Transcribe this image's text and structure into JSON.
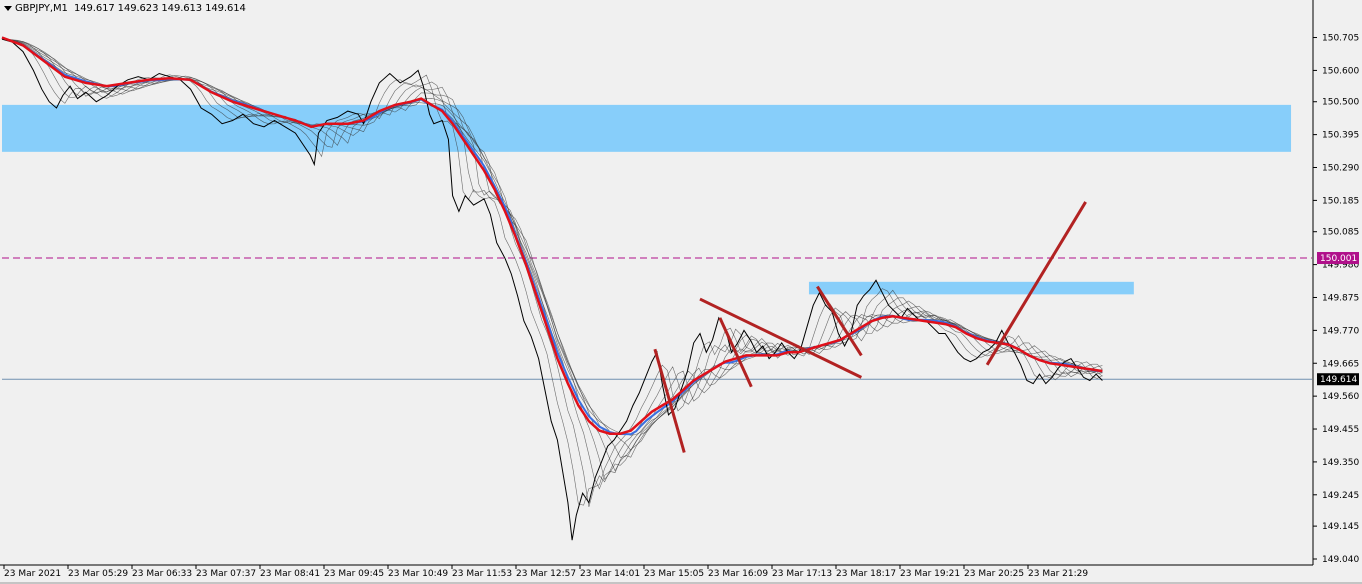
{
  "header": {
    "symbol": "GBPJPY,M1",
    "ohlc": "149.617 149.623 149.613 149.614"
  },
  "colors": {
    "background": "#f0f0f0",
    "price_line": "#000000",
    "ma_slow": "#e0101a",
    "ma_mid": "#3a6fe0",
    "zone_fill": "#87cefa",
    "level_line": "#b0108a",
    "trend_lines": "#b22222",
    "current_price_line": "#7090b0"
  },
  "chart_data": {
    "type": "line",
    "title": "GBPJPY,M1",
    "xlabel": "",
    "ylabel": "",
    "ylim": [
      149.04,
      150.745
    ],
    "y_ticks": [
      "150.705",
      "150.600",
      "150.500",
      "150.395",
      "150.290",
      "150.185",
      "150.085",
      "149.980",
      "149.875",
      "149.770",
      "149.665",
      "149.560",
      "149.455",
      "149.350",
      "149.245",
      "149.145",
      "149.040"
    ],
    "x_ticks": [
      "23 Mar 2021",
      "23 Mar 05:29",
      "23 Mar 06:33",
      "23 Mar 07:37",
      "23 Mar 08:41",
      "23 Mar 09:45",
      "23 Mar 10:49",
      "23 Mar 11:53",
      "23 Mar 12:57",
      "23 Mar 14:01",
      "23 Mar 15:05",
      "23 Mar 16:09",
      "23 Mar 17:13",
      "23 Mar 18:17",
      "23 Mar 19:21",
      "23 Mar 20:25",
      "23 Mar 21:29"
    ],
    "grid": false,
    "x_domain": [
      0,
      1000
    ],
    "price_path": [
      [
        0,
        150.7
      ],
      [
        10,
        150.69
      ],
      [
        20,
        150.66
      ],
      [
        30,
        150.6
      ],
      [
        38,
        150.54
      ],
      [
        45,
        150.5
      ],
      [
        52,
        150.48
      ],
      [
        58,
        150.52
      ],
      [
        65,
        150.55
      ],
      [
        72,
        150.51
      ],
      [
        80,
        150.53
      ],
      [
        90,
        150.5
      ],
      [
        100,
        150.52
      ],
      [
        110,
        150.55
      ],
      [
        120,
        150.57
      ],
      [
        130,
        150.58
      ],
      [
        140,
        150.57
      ],
      [
        150,
        150.59
      ],
      [
        160,
        150.58
      ],
      [
        170,
        150.57
      ],
      [
        180,
        150.54
      ],
      [
        190,
        150.48
      ],
      [
        200,
        150.46
      ],
      [
        210,
        150.43
      ],
      [
        220,
        150.44
      ],
      [
        230,
        150.46
      ],
      [
        240,
        150.43
      ],
      [
        250,
        150.42
      ],
      [
        260,
        150.44
      ],
      [
        270,
        150.42
      ],
      [
        280,
        150.4
      ],
      [
        288,
        150.36
      ],
      [
        294,
        150.33
      ],
      [
        298,
        150.3
      ],
      [
        302,
        150.4
      ],
      [
        310,
        150.44
      ],
      [
        320,
        150.45
      ],
      [
        330,
        150.47
      ],
      [
        340,
        150.46
      ],
      [
        345,
        150.43
      ],
      [
        352,
        150.5
      ],
      [
        360,
        150.56
      ],
      [
        370,
        150.59
      ],
      [
        380,
        150.56
      ],
      [
        390,
        150.58
      ],
      [
        397,
        150.6
      ],
      [
        402,
        150.55
      ],
      [
        408,
        150.46
      ],
      [
        412,
        150.43
      ],
      [
        420,
        150.44
      ],
      [
        426,
        150.38
      ],
      [
        430,
        150.2
      ],
      [
        436,
        150.15
      ],
      [
        442,
        150.2
      ],
      [
        450,
        150.17
      ],
      [
        460,
        150.19
      ],
      [
        466,
        150.14
      ],
      [
        472,
        150.05
      ],
      [
        480,
        150.0
      ],
      [
        486,
        149.95
      ],
      [
        492,
        149.88
      ],
      [
        498,
        149.8
      ],
      [
        505,
        149.75
      ],
      [
        512,
        149.68
      ],
      [
        518,
        149.58
      ],
      [
        524,
        149.48
      ],
      [
        530,
        149.42
      ],
      [
        536,
        149.3
      ],
      [
        540,
        149.22
      ],
      [
        544,
        149.1
      ],
      [
        548,
        149.18
      ],
      [
        554,
        149.25
      ],
      [
        560,
        149.22
      ],
      [
        566,
        149.3
      ],
      [
        572,
        149.35
      ],
      [
        578,
        149.4
      ],
      [
        584,
        149.42
      ],
      [
        590,
        149.45
      ],
      [
        596,
        149.48
      ],
      [
        602,
        149.53
      ],
      [
        608,
        149.57
      ],
      [
        614,
        149.62
      ],
      [
        620,
        149.67
      ],
      [
        625,
        149.7
      ],
      [
        630,
        149.6
      ],
      [
        636,
        149.5
      ],
      [
        642,
        149.52
      ],
      [
        648,
        149.58
      ],
      [
        654,
        149.64
      ],
      [
        660,
        149.73
      ],
      [
        666,
        149.76
      ],
      [
        672,
        149.7
      ],
      [
        678,
        149.74
      ],
      [
        684,
        149.81
      ],
      [
        690,
        149.78
      ],
      [
        696,
        149.7
      ],
      [
        702,
        149.73
      ],
      [
        708,
        149.77
      ],
      [
        714,
        149.74
      ],
      [
        720,
        149.7
      ],
      [
        726,
        149.72
      ],
      [
        732,
        149.68
      ],
      [
        738,
        149.7
      ],
      [
        744,
        149.73
      ],
      [
        750,
        149.7
      ],
      [
        756,
        149.68
      ],
      [
        762,
        149.71
      ],
      [
        768,
        149.78
      ],
      [
        774,
        149.85
      ],
      [
        780,
        149.89
      ],
      [
        786,
        149.85
      ],
      [
        792,
        149.83
      ],
      [
        798,
        149.76
      ],
      [
        804,
        149.72
      ],
      [
        810,
        149.76
      ],
      [
        816,
        149.85
      ],
      [
        822,
        149.88
      ],
      [
        828,
        149.9
      ],
      [
        834,
        149.93
      ],
      [
        840,
        149.89
      ],
      [
        846,
        149.85
      ],
      [
        852,
        149.83
      ],
      [
        858,
        149.81
      ],
      [
        864,
        149.84
      ],
      [
        870,
        149.82
      ],
      [
        876,
        149.8
      ],
      [
        882,
        149.8
      ],
      [
        888,
        149.78
      ],
      [
        894,
        149.76
      ],
      [
        900,
        149.76
      ],
      [
        906,
        149.73
      ],
      [
        912,
        149.7
      ],
      [
        918,
        149.68
      ],
      [
        924,
        149.67
      ],
      [
        930,
        149.68
      ],
      [
        936,
        149.7
      ],
      [
        942,
        149.71
      ],
      [
        948,
        149.73
      ],
      [
        954,
        149.77
      ],
      [
        960,
        149.73
      ],
      [
        966,
        149.7
      ],
      [
        972,
        149.66
      ],
      [
        978,
        149.61
      ],
      [
        984,
        149.6
      ],
      [
        990,
        149.63
      ],
      [
        996,
        149.6
      ],
      [
        1002,
        149.62
      ],
      [
        1008,
        149.65
      ],
      [
        1014,
        149.67
      ],
      [
        1020,
        149.68
      ],
      [
        1026,
        149.65
      ],
      [
        1032,
        149.62
      ],
      [
        1038,
        149.61
      ],
      [
        1044,
        149.63
      ],
      [
        1050,
        149.61
      ]
    ],
    "ma_slow_path": [
      [
        0,
        150.705
      ],
      [
        20,
        150.68
      ],
      [
        40,
        150.63
      ],
      [
        60,
        150.58
      ],
      [
        80,
        150.56
      ],
      [
        100,
        150.55
      ],
      [
        120,
        150.56
      ],
      [
        140,
        150.57
      ],
      [
        160,
        150.575
      ],
      [
        180,
        150.57
      ],
      [
        200,
        150.53
      ],
      [
        220,
        150.5
      ],
      [
        240,
        150.48
      ],
      [
        260,
        150.46
      ],
      [
        280,
        150.44
      ],
      [
        295,
        150.42
      ],
      [
        310,
        150.43
      ],
      [
        330,
        150.43
      ],
      [
        345,
        150.44
      ],
      [
        360,
        150.47
      ],
      [
        375,
        150.49
      ],
      [
        390,
        150.5
      ],
      [
        400,
        150.51
      ],
      [
        410,
        150.49
      ],
      [
        420,
        150.47
      ],
      [
        430,
        150.43
      ],
      [
        440,
        150.38
      ],
      [
        450,
        150.33
      ],
      [
        460,
        150.28
      ],
      [
        470,
        150.22
      ],
      [
        480,
        150.15
      ],
      [
        490,
        150.07
      ],
      [
        500,
        149.98
      ],
      [
        510,
        149.88
      ],
      [
        520,
        149.78
      ],
      [
        530,
        149.68
      ],
      [
        540,
        149.6
      ],
      [
        550,
        149.53
      ],
      [
        560,
        149.48
      ],
      [
        570,
        149.45
      ],
      [
        580,
        149.44
      ],
      [
        590,
        149.44
      ],
      [
        600,
        149.45
      ],
      [
        610,
        149.48
      ],
      [
        620,
        149.51
      ],
      [
        630,
        149.53
      ],
      [
        640,
        149.55
      ],
      [
        650,
        149.58
      ],
      [
        660,
        149.61
      ],
      [
        670,
        149.63
      ],
      [
        680,
        149.65
      ],
      [
        690,
        149.67
      ],
      [
        700,
        149.68
      ],
      [
        710,
        149.69
      ],
      [
        720,
        149.69
      ],
      [
        730,
        149.69
      ],
      [
        740,
        149.69
      ],
      [
        750,
        149.7
      ],
      [
        760,
        149.7
      ],
      [
        770,
        149.71
      ],
      [
        780,
        149.72
      ],
      [
        790,
        149.73
      ],
      [
        800,
        149.74
      ],
      [
        810,
        149.76
      ],
      [
        820,
        149.78
      ],
      [
        830,
        149.8
      ],
      [
        840,
        149.81
      ],
      [
        850,
        149.815
      ],
      [
        860,
        149.81
      ],
      [
        870,
        149.805
      ],
      [
        880,
        149.8
      ],
      [
        890,
        149.795
      ],
      [
        900,
        149.79
      ],
      [
        910,
        149.78
      ],
      [
        920,
        149.76
      ],
      [
        930,
        149.745
      ],
      [
        940,
        149.735
      ],
      [
        950,
        149.73
      ],
      [
        960,
        149.725
      ],
      [
        970,
        149.71
      ],
      [
        980,
        149.69
      ],
      [
        990,
        149.675
      ],
      [
        1000,
        149.665
      ],
      [
        1010,
        149.66
      ],
      [
        1020,
        149.655
      ],
      [
        1030,
        149.65
      ],
      [
        1040,
        149.645
      ],
      [
        1050,
        149.64
      ]
    ],
    "resistance_zones": [
      {
        "x0": 0,
        "x1": 1230,
        "y_top": 150.49,
        "y_bottom": 150.34
      },
      {
        "x0": 770,
        "x1": 1080,
        "y_top": 149.925,
        "y_bottom": 149.885
      }
    ],
    "horizontal_level": 150.001,
    "current_price": 149.614,
    "trend_lines": [
      {
        "from": [
          623,
          149.71
        ],
        "to": [
          651,
          149.38
        ]
      },
      {
        "from": [
          666,
          149.87
        ],
        "to": [
          820,
          149.62
        ]
      },
      {
        "from": [
          685,
          149.81
        ],
        "to": [
          715,
          149.59
        ]
      },
      {
        "from": [
          778,
          149.91
        ],
        "to": [
          820,
          149.69
        ]
      },
      {
        "from": [
          940,
          149.66
        ],
        "to": [
          1034,
          150.18
        ]
      }
    ],
    "price_tags": [
      {
        "label": "150.001",
        "value": 150.001,
        "color": "#b0108a"
      },
      {
        "label": "149.614",
        "value": 149.614,
        "color": "#000000"
      }
    ]
  }
}
